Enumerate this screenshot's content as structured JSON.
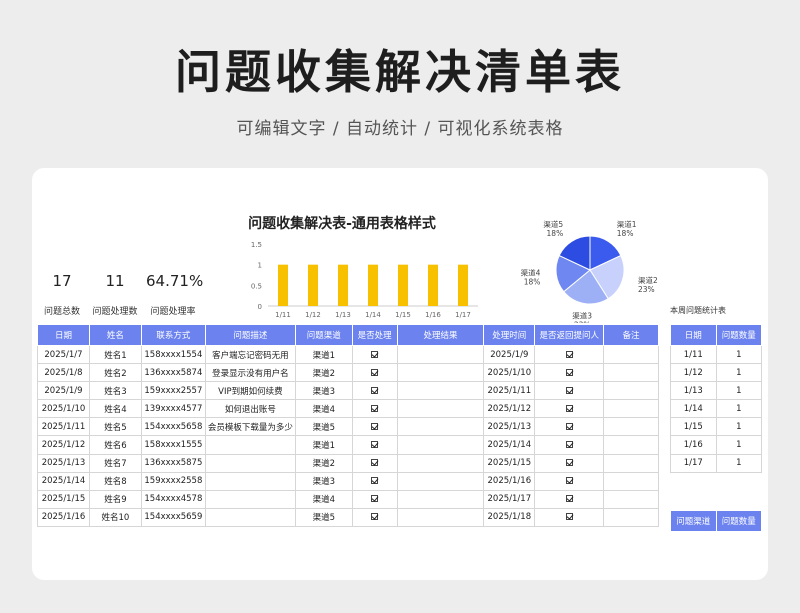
{
  "header": {
    "title": "问题收集解决清单表",
    "subtitle": "可编辑文字 / 自动统计 / 可视化系统表格"
  },
  "stats": [
    {
      "value": "17",
      "label": "问题总数"
    },
    {
      "value": "11",
      "label": "问题处理数"
    },
    {
      "value": "64.71%",
      "label": "问题处理率"
    }
  ],
  "chart_data": [
    {
      "type": "bar",
      "title": "问题收集解决表-通用表格样式",
      "categories": [
        "1/11",
        "1/12",
        "1/13",
        "1/14",
        "1/15",
        "1/16",
        "1/17"
      ],
      "values": [
        1,
        1,
        1,
        1,
        1,
        1,
        1
      ],
      "yticks": [
        "0",
        "0.5",
        "1",
        "1.5"
      ],
      "ylim": [
        0,
        1.5
      ],
      "color": "#f7c100"
    },
    {
      "type": "pie",
      "slices": [
        {
          "label": "渠道1",
          "pct": "18%",
          "value": 18,
          "color": "#3b5bef"
        },
        {
          "label": "渠道2",
          "pct": "23%",
          "value": 23,
          "color": "#c7d1fb"
        },
        {
          "label": "渠道3",
          "pct": "23%",
          "value": 23,
          "color": "#9db0f6"
        },
        {
          "label": "渠道4",
          "pct": "18%",
          "value": 18,
          "color": "#6f87f1"
        },
        {
          "label": "渠道5",
          "pct": "18%",
          "value": 18,
          "color": "#2d4ce2"
        }
      ]
    }
  ],
  "main_table": {
    "headers": [
      "日期",
      "姓名",
      "联系方式",
      "问题描述",
      "问题渠道",
      "是否处理",
      "处理结果",
      "处理时间",
      "是否返回提问人",
      "备注"
    ],
    "rows": [
      [
        "2025/1/7",
        "姓名1",
        "158xxxx1554",
        "客户端忘记密码无用",
        "渠道1",
        "check",
        "",
        "2025/1/9",
        "check",
        ""
      ],
      [
        "2025/1/8",
        "姓名2",
        "136xxxx5874",
        "登录显示没有用户名",
        "渠道2",
        "check",
        "",
        "2025/1/10",
        "check",
        ""
      ],
      [
        "2025/1/9",
        "姓名3",
        "159xxxx2557",
        "VIP到期如何续费",
        "渠道3",
        "check",
        "",
        "2025/1/11",
        "check",
        ""
      ],
      [
        "2025/1/10",
        "姓名4",
        "139xxxx4577",
        "如何退出账号",
        "渠道4",
        "check",
        "",
        "2025/1/12",
        "check",
        ""
      ],
      [
        "2025/1/11",
        "姓名5",
        "154xxxx5658",
        "会员模板下载量为多少",
        "渠道5",
        "check",
        "",
        "2025/1/13",
        "check",
        ""
      ],
      [
        "2025/1/12",
        "姓名6",
        "158xxxx1555",
        "",
        "渠道1",
        "check",
        "",
        "2025/1/14",
        "check",
        ""
      ],
      [
        "2025/1/13",
        "姓名7",
        "136xxxx5875",
        "",
        "渠道2",
        "check",
        "",
        "2025/1/15",
        "check",
        ""
      ],
      [
        "2025/1/14",
        "姓名8",
        "159xxxx2558",
        "",
        "渠道3",
        "check",
        "",
        "2025/1/16",
        "check",
        ""
      ],
      [
        "2025/1/15",
        "姓名9",
        "154xxxx4578",
        "",
        "渠道4",
        "check",
        "",
        "2025/1/17",
        "check",
        ""
      ],
      [
        "2025/1/16",
        "姓名10",
        "154xxxx5659",
        "",
        "渠道5",
        "check",
        "",
        "2025/1/18",
        "check",
        ""
      ]
    ]
  },
  "side_table": {
    "caption": "本周问题统计表",
    "headers": [
      "日期",
      "问题数量"
    ],
    "rows": [
      [
        "1/11",
        "1"
      ],
      [
        "1/12",
        "1"
      ],
      [
        "1/13",
        "1"
      ],
      [
        "1/14",
        "1"
      ],
      [
        "1/15",
        "1"
      ],
      [
        "1/16",
        "1"
      ],
      [
        "1/17",
        "1"
      ]
    ],
    "bottom_headers": [
      "问题渠道",
      "问题数量"
    ]
  }
}
